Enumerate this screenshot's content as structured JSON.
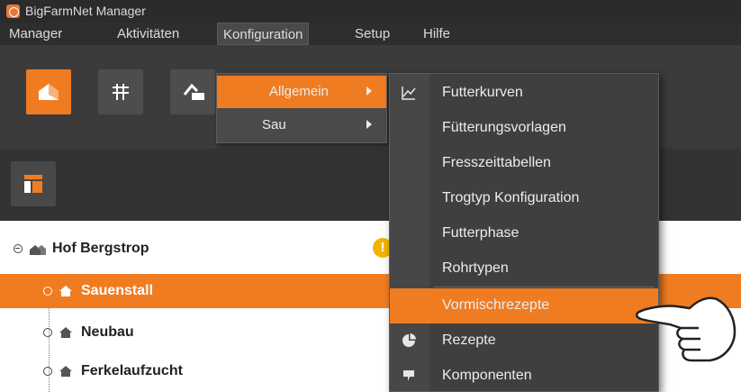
{
  "window": {
    "title": "BigFarmNet Manager",
    "icon": "app-logo-icon"
  },
  "menubar": {
    "items": [
      {
        "label": "Manager"
      },
      {
        "label": "Aktivitäten"
      },
      {
        "label": "Konfiguration",
        "open": true
      },
      {
        "label": "Setup"
      },
      {
        "label": "Hilfe"
      }
    ]
  },
  "toolbar": {
    "buttons": [
      {
        "icon": "barn-icon",
        "active": true
      },
      {
        "icon": "grid-icon",
        "active": false
      },
      {
        "icon": "feeding-icon",
        "active": false
      }
    ],
    "secondary_button_icon": "layout-icon"
  },
  "tree": {
    "root": {
      "label": "Hof Bergstrop",
      "icon": "farm-icon",
      "expanded": true,
      "warning": "!"
    },
    "items": [
      {
        "label": "Sauenstall",
        "selected": true
      },
      {
        "label": "Neubau",
        "selected": false
      },
      {
        "label": "Ferkelaufzucht",
        "selected": false
      }
    ]
  },
  "konfiguration_menu": {
    "items": [
      {
        "label": "Allgemein",
        "highlighted": true,
        "has_submenu": true
      },
      {
        "label": "Sau",
        "highlighted": false,
        "has_submenu": true
      }
    ]
  },
  "allgemein_submenu": {
    "items": [
      {
        "label": "Futterkurven",
        "icon": "line-chart-icon"
      },
      {
        "label": "Fütterungsvorlagen",
        "icon": ""
      },
      {
        "label": "Fresszeittabellen",
        "icon": ""
      },
      {
        "label": "Trogtyp Konfiguration",
        "icon": ""
      },
      {
        "label": "Futterphase",
        "icon": ""
      },
      {
        "label": "Rohrtypen",
        "icon": ""
      },
      {
        "label": "Vormischrezepte",
        "icon": "",
        "highlighted": true
      },
      {
        "label": "Rezepte",
        "icon": "pie-chart-icon"
      },
      {
        "label": "Komponenten",
        "icon": "components-icon"
      }
    ]
  },
  "colors": {
    "accent": "#f07c22",
    "titlebar": "#2b2b2b",
    "toolbar": "#3b3b3b",
    "menu_bg": "#3f3f3f",
    "warning": "#f0b400"
  }
}
